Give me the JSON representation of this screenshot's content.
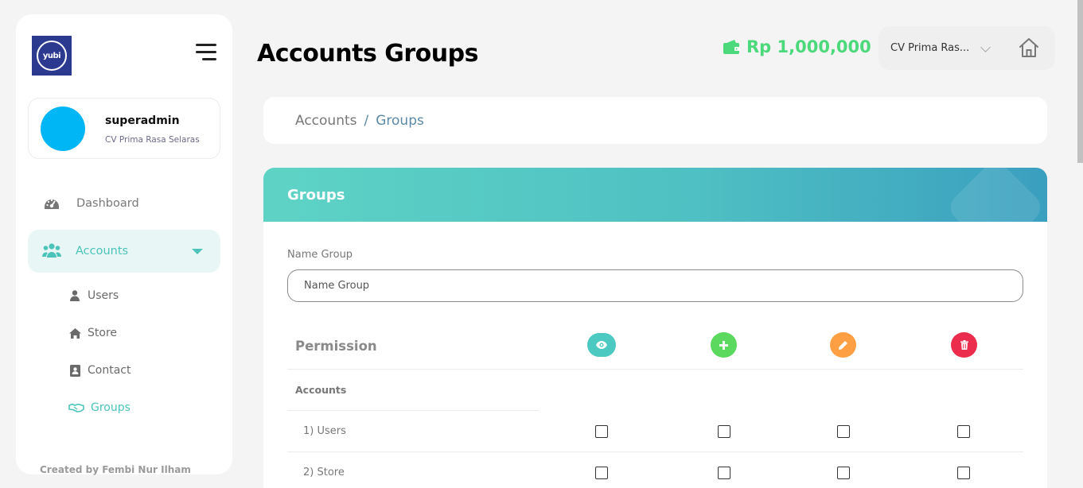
{
  "sidebar": {
    "logo_text": "yubi",
    "user": {
      "name": "superadmin",
      "company": "CV Prima Rasa Selaras"
    },
    "nav": {
      "dashboard": "Dashboard",
      "accounts": "Accounts"
    },
    "sub": {
      "users": "Users",
      "store": "Store",
      "contact": "Contact",
      "groups": "Groups"
    },
    "footer": "Created by Fembi Nur Ilham"
  },
  "header": {
    "title": "Accounts Groups",
    "balance": "Rp 1,000,000",
    "company_select": "CV Prima Ras..."
  },
  "breadcrumb": {
    "parent": "Accounts",
    "separator": "/",
    "current": "Groups"
  },
  "card": {
    "title": "Groups",
    "field_label": "Name Group",
    "field_placeholder": "Name Group",
    "permission_title": "Permission",
    "section": "Accounts",
    "rows": [
      "1) Users",
      "2) Store"
    ]
  },
  "colors": {
    "accent_teal": "#4bc3b9",
    "balance_green": "#4cd97b",
    "view": "#4cc9c0",
    "add": "#5bd95f",
    "edit": "#ff9f43",
    "delete": "#ec2c4c"
  }
}
